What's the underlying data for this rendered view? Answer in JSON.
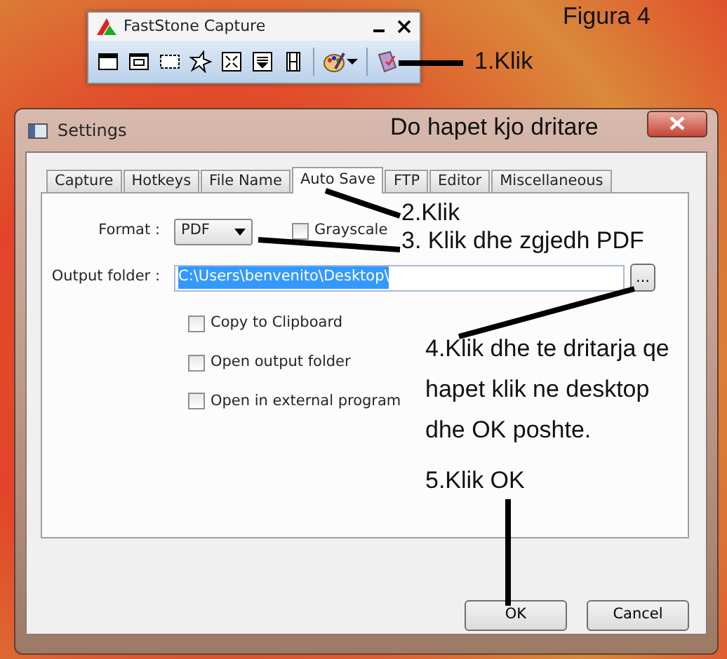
{
  "toolbar_window": {
    "title": "FastStone Capture"
  },
  "settings_dialog": {
    "title": "Settings",
    "tabs": [
      {
        "label": "Capture",
        "selected": false
      },
      {
        "label": "Hotkeys",
        "selected": false
      },
      {
        "label": "File Name",
        "selected": false
      },
      {
        "label": "Auto Save",
        "selected": true
      },
      {
        "label": "FTP",
        "selected": false
      },
      {
        "label": "Editor",
        "selected": false
      },
      {
        "label": "Miscellaneous",
        "selected": false
      }
    ],
    "format": {
      "label": "Format :",
      "value": "PDF"
    },
    "grayscale": {
      "label": "Grayscale",
      "checked": false
    },
    "output_folder": {
      "label": "Output folder :",
      "value": "C:\\Users\\benvenito\\Desktop\\",
      "text_selected": true
    },
    "browse_button": "...",
    "options": [
      {
        "label": "Copy to Clipboard",
        "checked": false
      },
      {
        "label": "Open output folder",
        "checked": false
      },
      {
        "label": "Open in external program",
        "checked": false
      }
    ],
    "buttons": [
      "OK",
      "Cancel"
    ]
  },
  "annotations": [
    {
      "lines": [
        "Figura 4"
      ]
    },
    {
      "lines": [
        "1.Klik"
      ]
    },
    {
      "lines": [
        "Do hapet kjo dritare"
      ]
    },
    {
      "lines": [
        "2.Klik"
      ]
    },
    {
      "lines": [
        "3. Klik dhe zgjedh PDF"
      ]
    },
    {
      "lines": [
        "4.Klik dhe te dritarja qe",
        "hapet klik ne desktop",
        "dhe OK poshte."
      ]
    },
    {
      "lines": [
        "5.Klik OK"
      ]
    }
  ]
}
